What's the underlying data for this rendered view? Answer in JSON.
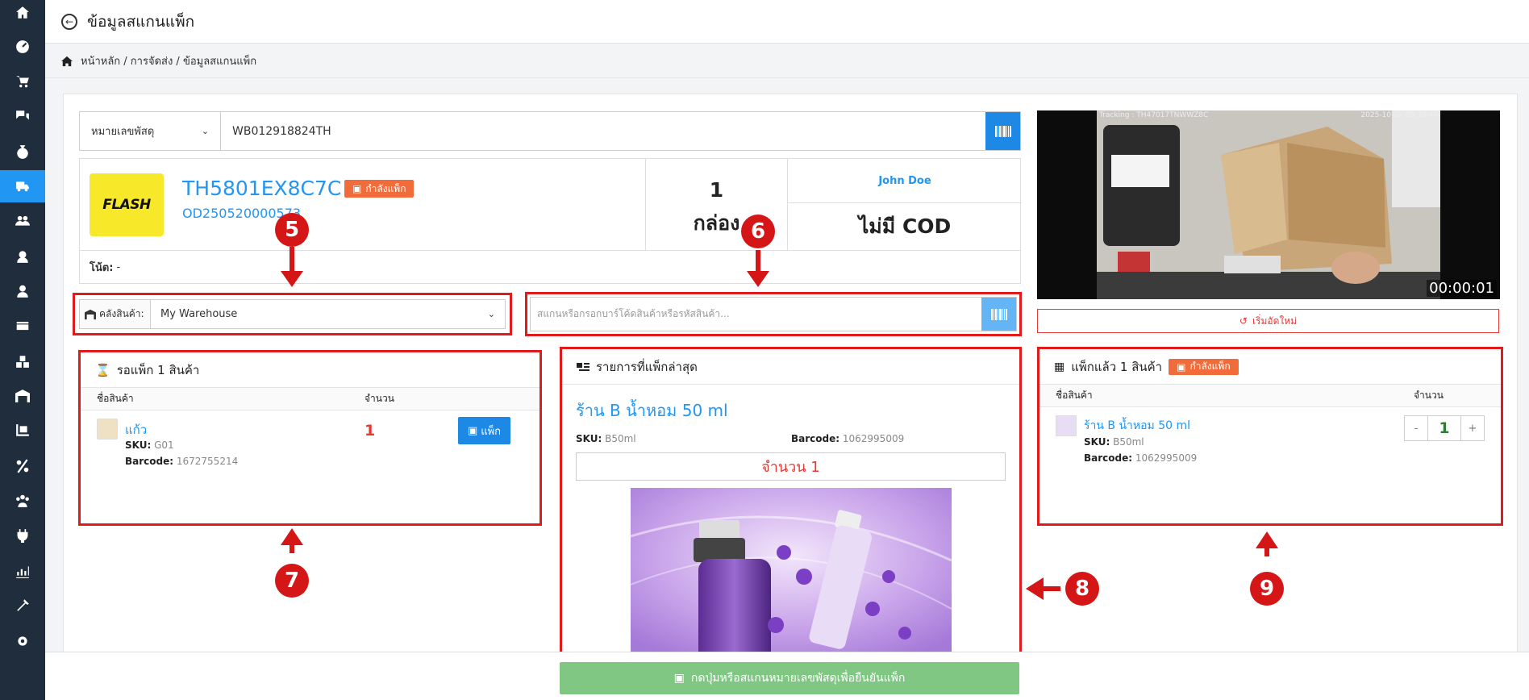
{
  "header": {
    "title": "ข้อมูลสแกนแพ็ก"
  },
  "breadcrumb": "หน้าหลัก / การจัดส่ง / ข้อมูลสแกนแพ็ก",
  "search": {
    "type_label": "หมายเลขพัสดุ",
    "value": "WB012918824TH"
  },
  "order": {
    "carrier_logo_text": "FLASH",
    "tracking_no": "TH5801EX8C7C",
    "status": "กำลังแพ็ก",
    "order_no": "OD250520000573",
    "box_count": "1",
    "box_unit": "กล่อง",
    "customer": "John Doe",
    "cod": "ไม่มี COD",
    "note_label": "โน้ต:",
    "note_value": "-"
  },
  "warehouse": {
    "label": "คลังสินค้า:",
    "value": "My Warehouse"
  },
  "product_scan": {
    "placeholder": "สแกนหรือกรอกบาร์โค้ดสินค้าหรือรหัสสินค้า..."
  },
  "pending": {
    "title": "รอแพ็ก 1 สินค้า",
    "col_name": "ชื่อสินค้า",
    "col_qty": "จำนวน",
    "items": [
      {
        "name": "แก้ว",
        "sku_label": "SKU:",
        "sku": "G01",
        "barcode_label": "Barcode:",
        "barcode": "1672755214",
        "qty": "1",
        "action": "แพ็ก"
      }
    ]
  },
  "latest": {
    "title": "รายการที่แพ็กล่าสุด",
    "product": "ร้าน B น้ำหอม 50 ml",
    "sku_label": "SKU:",
    "sku": "B50ml",
    "barcode_label": "Barcode:",
    "barcode": "1062995009",
    "qty_text": "จำนวน 1"
  },
  "packed": {
    "title": "แพ็กแล้ว 1 สินค้า",
    "status": "กำลังแพ็ก",
    "col_name": "ชื่อสินค้า",
    "col_qty": "จำนวน",
    "items": [
      {
        "name": "ร้าน B น้ำหอม 50 ml",
        "sku_label": "SKU:",
        "sku": "B50ml",
        "barcode_label": "Barcode:",
        "barcode": "1062995009",
        "qty": "1",
        "minus": "-",
        "plus": "+"
      }
    ]
  },
  "video": {
    "tracking_overlay": "Tracking : TH47017TNWWZ8C",
    "datetime_overlay": "2025-10-02 09:38:40",
    "timer": "00:00:01"
  },
  "restart_label": "เริ่มอัดใหม่",
  "confirm_label": "กดปุ่มหรือสแกนหมายเลขพัสดุเพื่อยืนยันแพ็ก",
  "callouts": [
    "5",
    "6",
    "7",
    "8",
    "9"
  ],
  "colors": {
    "accent": "#2196f3",
    "callout": "#d41616",
    "badge": "#f26b3a",
    "confirm": "#81c784"
  }
}
